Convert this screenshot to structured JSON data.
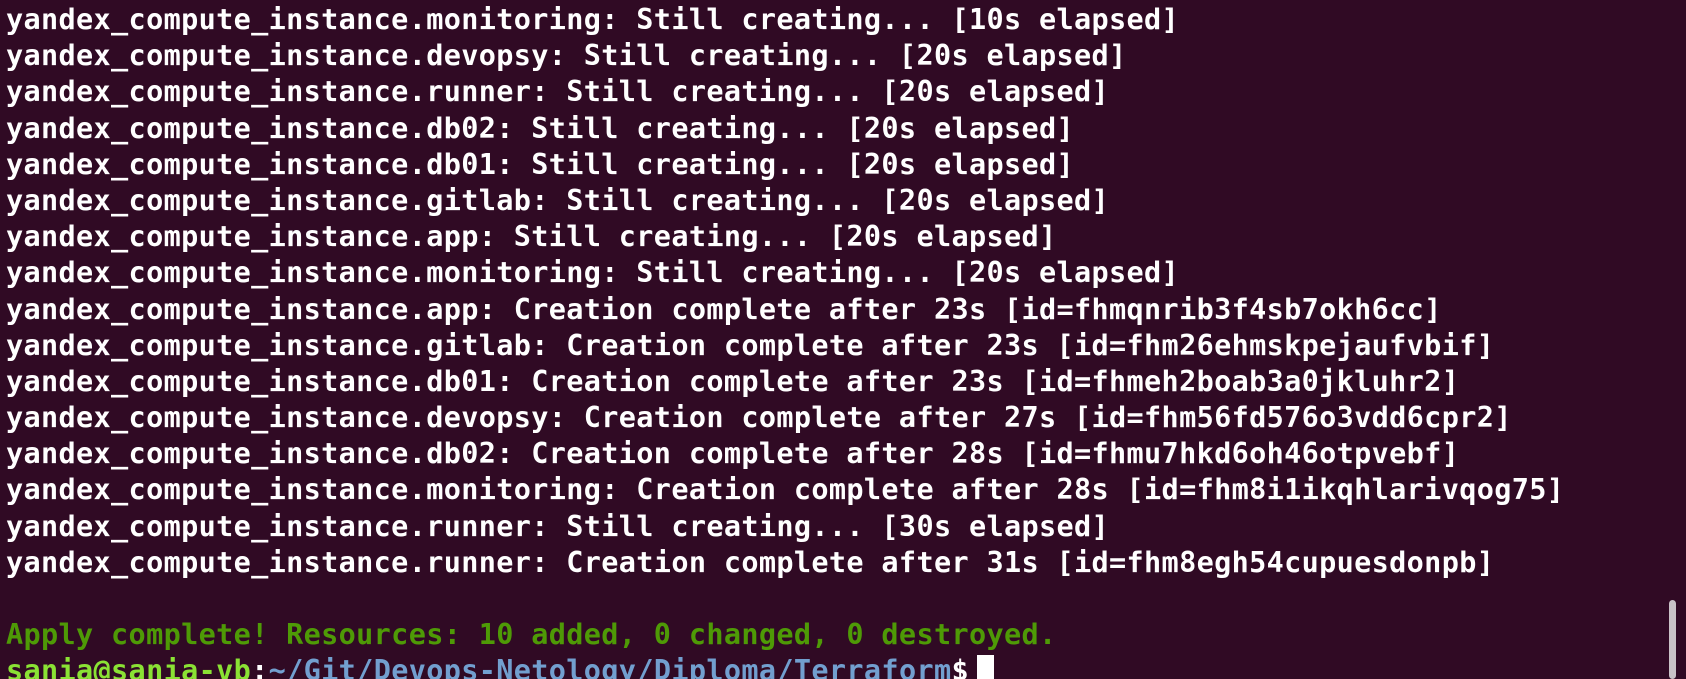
{
  "terminal": {
    "lines": [
      "yandex_compute_instance.monitoring: Still creating... [10s elapsed]",
      "yandex_compute_instance.devopsy: Still creating... [20s elapsed]",
      "yandex_compute_instance.runner: Still creating... [20s elapsed]",
      "yandex_compute_instance.db02: Still creating... [20s elapsed]",
      "yandex_compute_instance.db01: Still creating... [20s elapsed]",
      "yandex_compute_instance.gitlab: Still creating... [20s elapsed]",
      "yandex_compute_instance.app: Still creating... [20s elapsed]",
      "yandex_compute_instance.monitoring: Still creating... [20s elapsed]",
      "yandex_compute_instance.app: Creation complete after 23s [id=fhmqnrib3f4sb7okh6cc]",
      "yandex_compute_instance.gitlab: Creation complete after 23s [id=fhm26ehmskpejaufvbif]",
      "yandex_compute_instance.db01: Creation complete after 23s [id=fhmeh2boab3a0jkluhr2]",
      "yandex_compute_instance.devopsy: Creation complete after 27s [id=fhm56fd576o3vdd6cpr2]",
      "yandex_compute_instance.db02: Creation complete after 28s [id=fhmu7hkd6oh46otpvebf]",
      "yandex_compute_instance.monitoring: Creation complete after 28s [id=fhm8i1ikqhlarivqog75]",
      "yandex_compute_instance.runner: Still creating... [30s elapsed]",
      "yandex_compute_instance.runner: Creation complete after 31s [id=fhm8egh54cupuesdonpb]"
    ],
    "apply_summary": "Apply complete! Resources: 10 added, 0 changed, 0 destroyed.",
    "prompt": {
      "user_host": "sania@sania-vb",
      "separator": ":",
      "path": "~/Git/Devops-Netology/Diploma/Terraform",
      "symbol": "$"
    },
    "colors": {
      "background": "#300a24",
      "text": "#ffffff",
      "success": "#4e9a06",
      "user_host": "#8ae234",
      "path": "#729fcf"
    }
  }
}
